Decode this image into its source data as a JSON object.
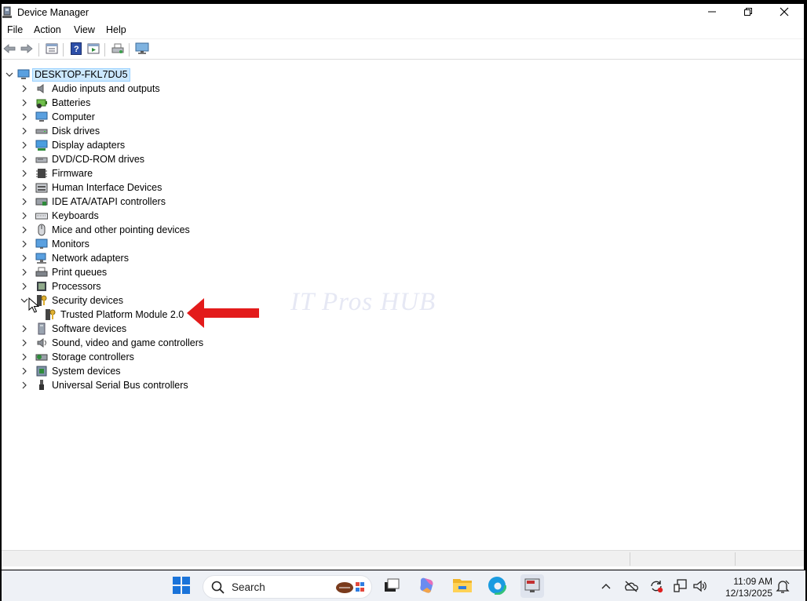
{
  "window": {
    "title": "Device Manager",
    "controls": {
      "minimize": "minimize-icon",
      "maximize": "restore-icon",
      "close": "close-icon"
    }
  },
  "menu": [
    "File",
    "Action",
    "View",
    "Help"
  ],
  "toolbar": {
    "buttons": [
      "back-icon",
      "forward-icon",
      "properties-icon",
      "help-icon",
      "update-driver-icon",
      "print-icon",
      "monitor-icon"
    ]
  },
  "tree": {
    "root": "DESKTOP-FKL7DU5",
    "categories": [
      {
        "label": "Audio inputs and outputs",
        "icon": "speaker-icon",
        "expanded": false
      },
      {
        "label": "Batteries",
        "icon": "battery-icon",
        "expanded": false
      },
      {
        "label": "Computer",
        "icon": "computer-icon",
        "expanded": false
      },
      {
        "label": "Disk drives",
        "icon": "disk-drive-icon",
        "expanded": false
      },
      {
        "label": "Display adapters",
        "icon": "display-adapter-icon",
        "expanded": false
      },
      {
        "label": "DVD/CD-ROM drives",
        "icon": "dvd-drive-icon",
        "expanded": false
      },
      {
        "label": "Firmware",
        "icon": "firmware-icon",
        "expanded": false
      },
      {
        "label": "Human Interface Devices",
        "icon": "hid-icon",
        "expanded": false
      },
      {
        "label": "IDE ATA/ATAPI controllers",
        "icon": "ide-controller-icon",
        "expanded": false
      },
      {
        "label": "Keyboards",
        "icon": "keyboard-icon",
        "expanded": false
      },
      {
        "label": "Mice and other pointing devices",
        "icon": "mouse-icon",
        "expanded": false
      },
      {
        "label": "Monitors",
        "icon": "monitor-icon",
        "expanded": false
      },
      {
        "label": "Network adapters",
        "icon": "network-adapter-icon",
        "expanded": false
      },
      {
        "label": "Print queues",
        "icon": "printer-icon",
        "expanded": false
      },
      {
        "label": "Processors",
        "icon": "processor-icon",
        "expanded": false
      },
      {
        "label": "Security devices",
        "icon": "security-device-icon",
        "expanded": true,
        "children": [
          {
            "label": "Trusted Platform Module 2.0",
            "icon": "tpm-icon"
          }
        ]
      },
      {
        "label": "Software devices",
        "icon": "software-device-icon",
        "expanded": false
      },
      {
        "label": "Sound, video and game controllers",
        "icon": "sound-controller-icon",
        "expanded": false
      },
      {
        "label": "Storage controllers",
        "icon": "storage-controller-icon",
        "expanded": false
      },
      {
        "label": "System devices",
        "icon": "system-device-icon",
        "expanded": false
      },
      {
        "label": "Universal Serial Bus controllers",
        "icon": "usb-icon",
        "expanded": false
      }
    ]
  },
  "watermark": "IT Pros HUB",
  "annotation": {
    "arrow_color": "#e31b1b"
  },
  "taskbar": {
    "search_label": "Search",
    "apps": [
      "start-icon",
      "search-icon",
      "widgets-icon",
      "task-view-icon",
      "copilot-icon",
      "file-explorer-icon",
      "edge-icon",
      "device-manager-app-icon"
    ],
    "tray": [
      "chevron-up-icon",
      "onedrive-offline-icon",
      "sync-icon",
      "display-icon",
      "volume-icon"
    ],
    "time": "11:09 AM",
    "date": "12/13/2025"
  },
  "colors": {
    "selection_bg": "#cce8ff",
    "selection_border": "#99d1ff",
    "taskbar_bg": "#eef1f6"
  }
}
